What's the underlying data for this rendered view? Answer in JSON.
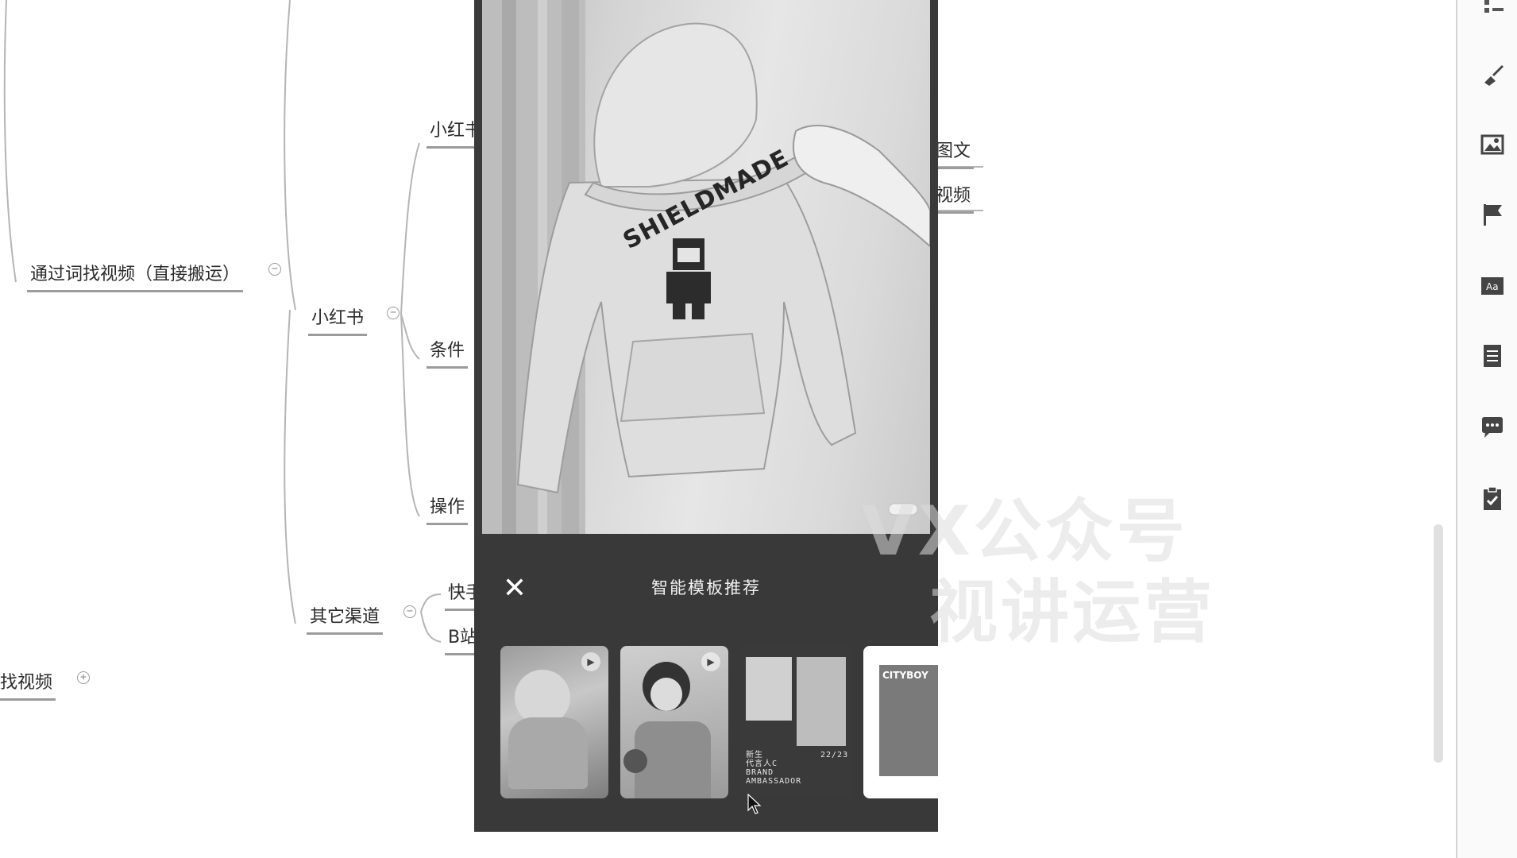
{
  "mindmap": {
    "root_partial": "找视频",
    "branch_top": "通过词找视频（直接搬运）",
    "platform_xhs": "小红书",
    "xhs_children": {
      "xhs_truncated": "小红书",
      "conditions": "条件",
      "operation": "操作"
    },
    "right_children": {
      "image_text": "图文",
      "video": "视频"
    },
    "other_channels": "其它渠道",
    "other_children": {
      "kuaishou": "快手",
      "bilibili": "B站"
    }
  },
  "phone": {
    "hoodie_print": "SHIELDMADE",
    "panel_title": "智能模板推荐",
    "close_icon": "close-icon",
    "templates": [
      {
        "label": "template-1"
      },
      {
        "label": "template-2"
      },
      {
        "label": "template-3",
        "text_lines": [
          "新生",
          "代言人C",
          "BRAND",
          "AMBASSADOR"
        ],
        "date": "22/23"
      },
      {
        "label": "template-4",
        "brand": "CITYBOY"
      }
    ]
  },
  "watermark": {
    "line1": "VX公众号",
    "line2": "视讲运营"
  },
  "toolbar": {
    "icons": [
      "outline-icon",
      "brush-icon",
      "image-icon",
      "flag-icon",
      "text-box-icon",
      "note-icon",
      "comment-icon",
      "task-icon"
    ]
  }
}
